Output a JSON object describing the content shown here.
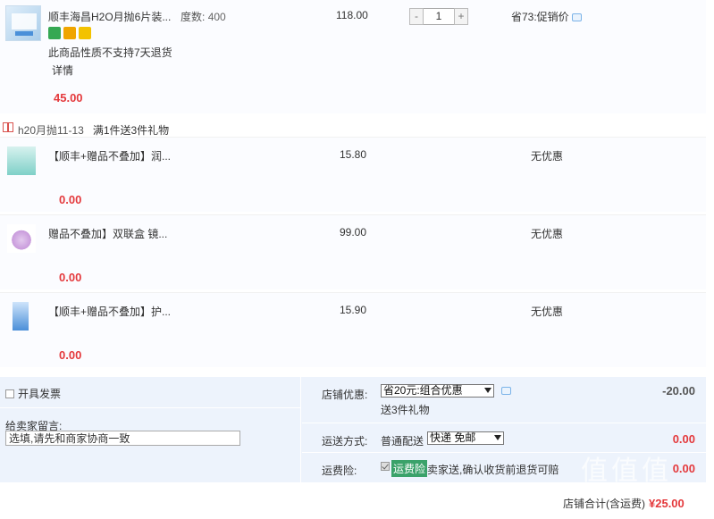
{
  "main_item": {
    "title": "顺丰海昌H2O月抛6片装...",
    "spec_label": "度数:",
    "spec_value": "400",
    "unit_price": "118.00",
    "qty_minus": "-",
    "quantity": "1",
    "qty_plus": "+",
    "promo": "省73:促销价",
    "notice": "此商品性质不支持7天退货",
    "detail": "详情",
    "subtotal": "45.00"
  },
  "gift_group": {
    "name": "h20月抛11-13",
    "rule": "满1件送3件礼物",
    "items": [
      {
        "title": "【顺丰+赠品不叠加】润...",
        "price": "15.80",
        "discount": "无优惠",
        "subtotal": "0.00"
      },
      {
        "title": "赠品不叠加】双联盒 镜...",
        "price": "99.00",
        "discount": "无优惠",
        "subtotal": "0.00"
      },
      {
        "title": "【顺丰+赠品不叠加】护...",
        "price": "15.90",
        "discount": "无优惠",
        "subtotal": "0.00"
      }
    ]
  },
  "order": {
    "invoice_label": "开具发票",
    "message_label": "给卖家留言:",
    "message_value": "选填,请先和商家协商一致",
    "shop_discount_label": "店铺优惠:",
    "shop_discount_selected": "省20元:组合优惠",
    "shop_discount_extra": "送3件礼物",
    "shop_discount_amount": "-20.00",
    "shipping_label": "运送方式:",
    "shipping_type": "普通配送",
    "shipping_selected": "快递 免邮",
    "shipping_amount": "0.00",
    "insurance_label": "运费险:",
    "insurance_tag": "运费险",
    "insurance_text": "卖家送,确认收货前退货可赔",
    "insurance_amount": "0.00",
    "total_label": "店铺合计(含运费)",
    "total_amount": "¥25.00"
  },
  "watermark": "值值值"
}
